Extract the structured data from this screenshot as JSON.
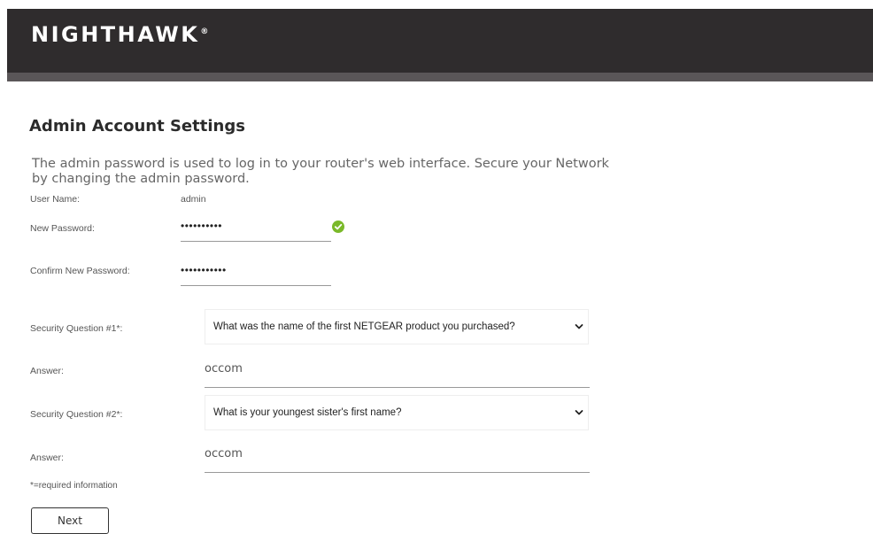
{
  "header": {
    "brand": "NIGHTHAWK",
    "brand_mark": "®"
  },
  "page": {
    "title": "Admin Account Settings",
    "description": "The admin password is used to log in to your router's web interface. Secure your Network by changing the admin password."
  },
  "form": {
    "user_name_label": "User Name:",
    "user_name_value": "admin",
    "new_password_label": "New Password:",
    "new_password_value": "••••••••••",
    "confirm_password_label": "Confirm New Password:",
    "confirm_password_value": "•••••••••••",
    "security_q1_label": "Security Question #1*:",
    "security_q1_value": "What was the name of the first NETGEAR product you purchased?",
    "answer1_label": "Answer:",
    "answer1_value": "occom",
    "security_q2_label": "Security Question #2*:",
    "security_q2_value": "What is your youngest sister's first name?",
    "answer2_label": "Answer:",
    "answer2_value": "occom",
    "required_note": "*=required information",
    "next_label": "Next"
  },
  "icons": {
    "password_valid": "check-circle-icon",
    "dropdown": "chevron-down-icon"
  },
  "colors": {
    "header_bg": "#2f2c2d",
    "header_band": "#5a5658",
    "valid_green": "#7ab929"
  }
}
